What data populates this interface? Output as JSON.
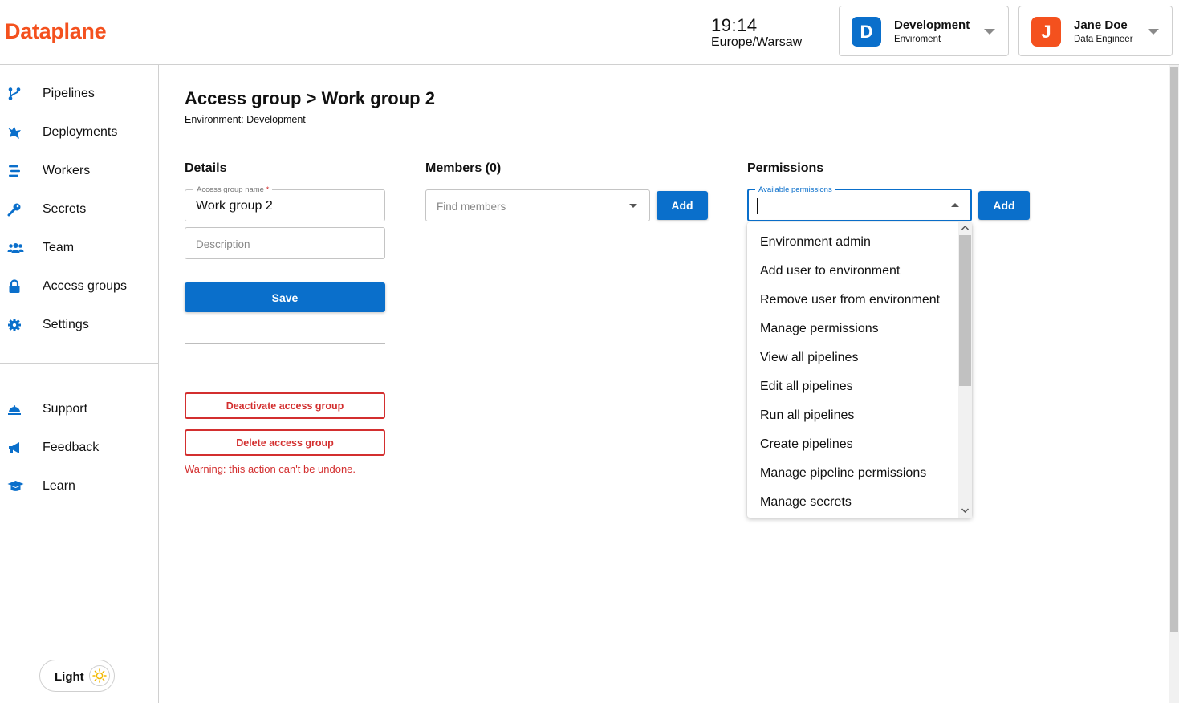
{
  "colors": {
    "brand": "#f4511e",
    "primary": "#0a6fcb",
    "danger": "#d32f2f",
    "env_badge": "#0a6fcb",
    "user_badge": "#f4511e"
  },
  "header": {
    "logo": "Dataplane",
    "time": "19:14",
    "timezone": "Europe/Warsaw",
    "environment": {
      "badge": "D",
      "name": "Development",
      "label": "Enviroment"
    },
    "user": {
      "badge": "J",
      "name": "Jane Doe",
      "role": "Data Engineer"
    }
  },
  "sidebar": {
    "items": [
      {
        "label": "Pipelines",
        "icon": "pipelines-icon"
      },
      {
        "label": "Deployments",
        "icon": "deployments-icon"
      },
      {
        "label": "Workers",
        "icon": "workers-icon"
      },
      {
        "label": "Secrets",
        "icon": "key-icon"
      },
      {
        "label": "Team",
        "icon": "team-icon"
      },
      {
        "label": "Access groups",
        "icon": "lock-icon"
      },
      {
        "label": "Settings",
        "icon": "gear-icon"
      }
    ],
    "bottom_items": [
      {
        "label": "Support",
        "icon": "support-bell-icon"
      },
      {
        "label": "Feedback",
        "icon": "megaphone-icon"
      },
      {
        "label": "Learn",
        "icon": "graduation-cap-icon"
      }
    ],
    "theme_label": "Light"
  },
  "page": {
    "title": "Access group > Work group 2",
    "subtitle": "Environment: Development"
  },
  "details": {
    "heading": "Details",
    "name_label": "Access group name",
    "name_required": "*",
    "name_value": "Work group 2",
    "description_placeholder": "Description",
    "save_label": "Save",
    "deactivate_label": "Deactivate access group",
    "delete_label": "Delete access group",
    "warning": "Warning: this action can't be undone."
  },
  "members": {
    "heading": "Members (0)",
    "find_placeholder": "Find members",
    "add_label": "Add"
  },
  "permissions": {
    "heading": "Permissions",
    "field_label": "Available permissions",
    "value": "",
    "add_label": "Add",
    "options": [
      "Environment admin",
      "Add user to environment",
      "Remove user from environment",
      "Manage permissions",
      "View all pipelines",
      "Edit all pipelines",
      "Run all pipelines",
      "Create pipelines",
      "Manage pipeline permissions",
      "Manage secrets"
    ]
  }
}
